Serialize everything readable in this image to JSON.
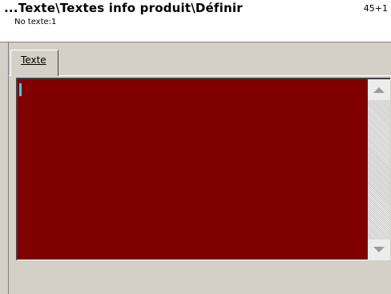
{
  "window": {
    "title": "...Texte\\Textes info produit\\Définir",
    "counter": "45+1",
    "subtitle": "No texte:1"
  },
  "tabs": [
    {
      "label": "Texte",
      "active": true
    }
  ],
  "editor": {
    "background": "#800000",
    "caret_color": "#2ad3e6",
    "value": ""
  },
  "icons": {
    "scroll_up": "triangle-up-icon",
    "scroll_down": "triangle-down-icon"
  }
}
